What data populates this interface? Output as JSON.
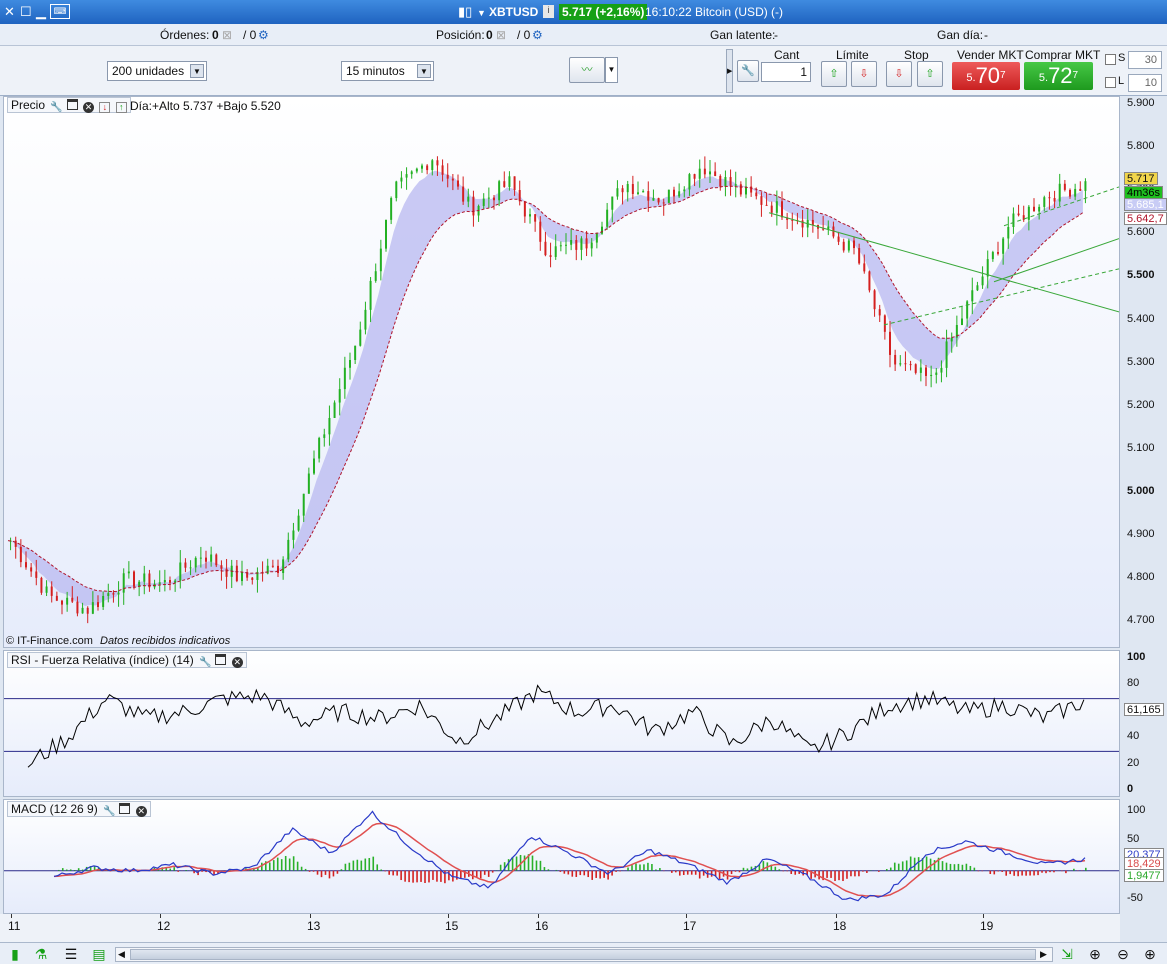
{
  "titlebar": {
    "symbol": "XBTUSD",
    "price_change": "5.717 (+2,16%)",
    "time_name": "16:10:22 Bitcoin (USD) (-)"
  },
  "status": {
    "orders_label": "Órdenes:",
    "orders_value": "0",
    "orders_total": "/ 0",
    "position_label": "Posición:",
    "position_value": "0",
    "position_total": "/ 0",
    "latent_label": "Gan latente:",
    "latent_value": "-",
    "day_label": "Gan día:",
    "day_value": "-"
  },
  "toolbar": {
    "quantity_select": "200 unidades",
    "timeframe_select": "15 minutos",
    "qty_header": "Cant",
    "qty_value": "1",
    "limit_header": "Límite",
    "stop_header": "Stop",
    "sell_header": "Vender MKT",
    "buy_header": "Comprar MKT",
    "sell_price_prefix": "5.",
    "sell_price_big": "70",
    "sell_price_sup": "7",
    "buy_price_prefix": "5.",
    "buy_price_big": "72",
    "buy_price_sup": "7",
    "s_label": "S",
    "s_value": "30",
    "l_label": "L",
    "l_value": "10"
  },
  "price_panel": {
    "title": "Precio",
    "day_info": "Día:+Alto 5.737 +Bajo 5.520",
    "copyright": "© IT-Finance.com",
    "disclaimer": "Datos recibidos indicativos",
    "y_ticks": [
      "5.900",
      "5.800",
      "5.700",
      "5.600",
      "5.500",
      "5.400",
      "5.300",
      "5.200",
      "5.100",
      "5.000",
      "4.900",
      "4.800",
      "4.700"
    ],
    "tags": {
      "last": "5.717",
      "timer": "4m36s",
      "ma1": "5.685,1",
      "ma2": "5.642,7"
    }
  },
  "rsi_panel": {
    "title": "RSI - Fuerza Relativa (índice) (14)",
    "y_ticks": [
      "100",
      "80",
      "60",
      "40",
      "20",
      "0"
    ],
    "tag": "61,165"
  },
  "macd_panel": {
    "title": "MACD (12 26 9)",
    "y_ticks": [
      "100",
      "50",
      "-50"
    ],
    "tags": {
      "macd": "20,377",
      "signal": "18,429",
      "hist": "1,9477"
    }
  },
  "x_ticks": [
    "11",
    "12",
    "13",
    "15",
    "16",
    "17",
    "18",
    "19"
  ],
  "colors": {
    "up": "#22b022",
    "down": "#d42020",
    "accent": "#1f63c0",
    "sell": "#e03a3a",
    "buy": "#2ab02a"
  },
  "chart_data": {
    "type": "line",
    "title": "",
    "x": [
      "11",
      "12",
      "13",
      "15",
      "16",
      "17",
      "18",
      "19"
    ],
    "series": [],
    "close_path": [
      4890,
      4760,
      4730,
      4800,
      4790,
      4860,
      4800,
      4830,
      5100,
      5350,
      5700,
      5780,
      5660,
      5720,
      5560,
      5580,
      5720,
      5680,
      5760,
      5700,
      5660,
      5620,
      5560,
      5300,
      5260,
      5450,
      5620,
      5690,
      5717
    ],
    "ylim": [
      4680,
      5900
    ],
    "rsi": [
      20,
      40,
      70,
      55,
      60,
      70,
      72,
      52,
      60,
      55,
      65,
      38,
      55,
      75,
      60,
      65,
      45,
      60,
      35,
      55,
      30,
      45,
      65,
      70,
      60,
      65,
      55,
      68
    ],
    "rsi_ylim": [
      0,
      100
    ],
    "macd": [
      -10,
      5,
      0,
      10,
      -5,
      5,
      70,
      30,
      100,
      40,
      -10,
      -30,
      60,
      30,
      -5,
      35,
      10,
      -20,
      20,
      -10,
      -50,
      -40,
      30,
      50,
      30,
      10,
      20
    ],
    "macd_ylim": [
      -60,
      110
    ]
  }
}
